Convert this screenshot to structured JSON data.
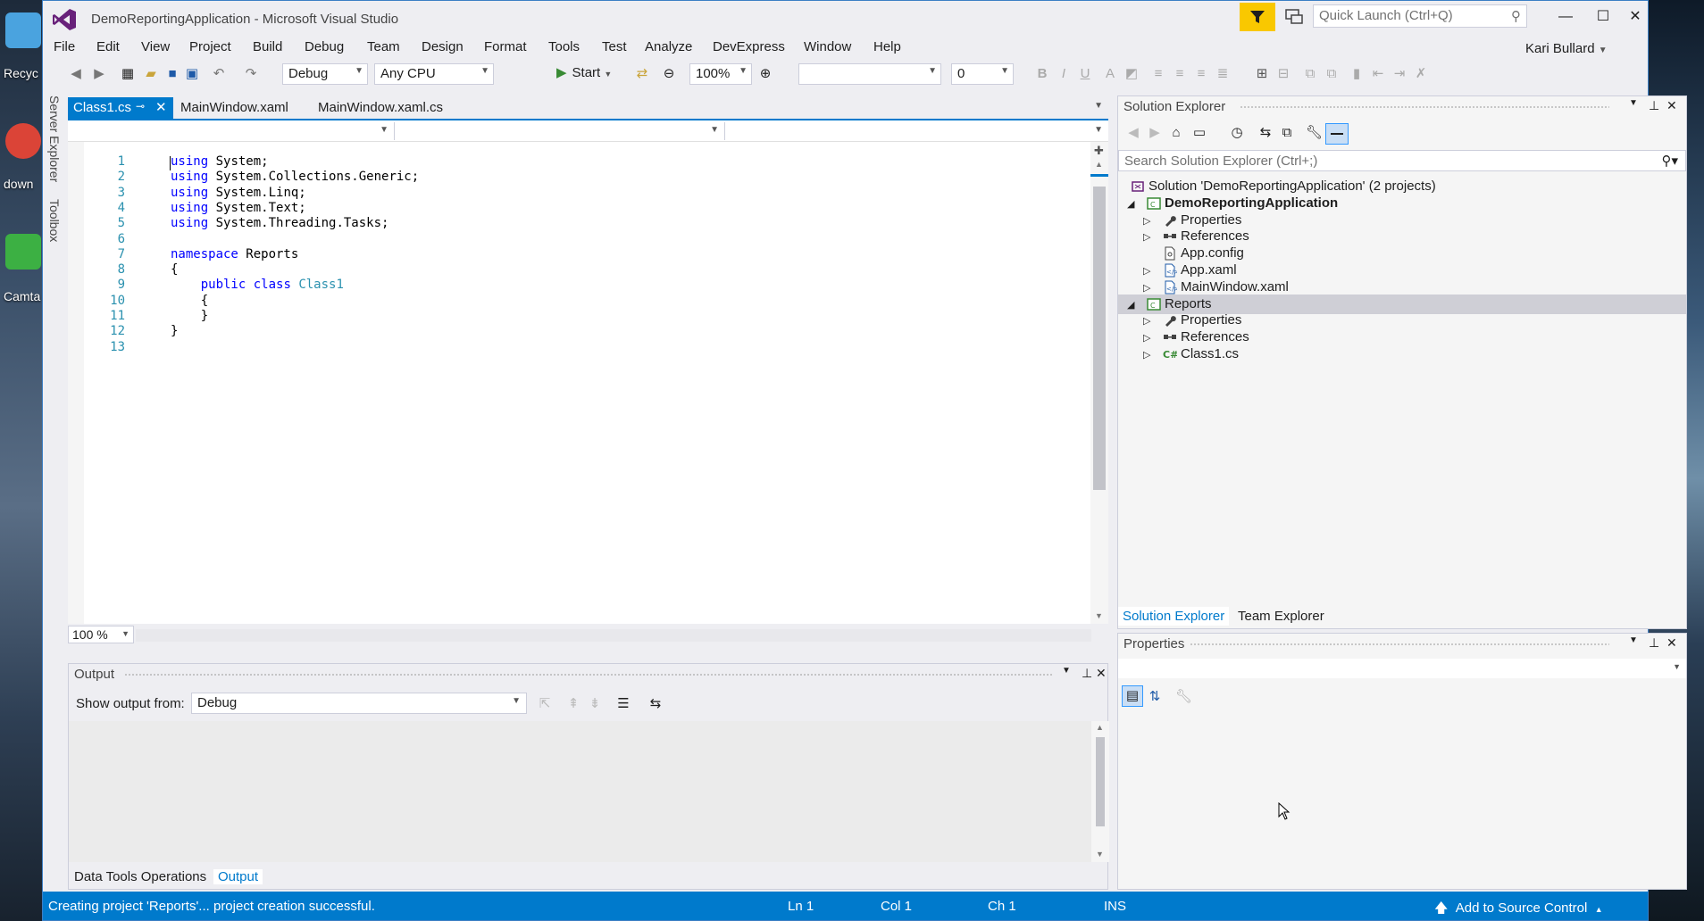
{
  "desktop": {
    "icons": [
      {
        "label": "Recyc",
        "color": "#4aa3df"
      },
      {
        "label": "down",
        "color": "#db4437"
      },
      {
        "label": "Camta",
        "color": "#3cb043"
      }
    ]
  },
  "window": {
    "title": "DemoReportingApplication - Microsoft Visual Studio",
    "quick_launch_placeholder": "Quick Launch (Ctrl+Q)",
    "minimize": "—",
    "maximize": "☐",
    "close": "✕"
  },
  "menu": [
    "File",
    "Edit",
    "View",
    "Project",
    "Build",
    "Debug",
    "Team",
    "Design",
    "Format",
    "Tools",
    "Test",
    "Analyze",
    "DevExpress",
    "Window",
    "Help"
  ],
  "user": {
    "name": "Kari Bullard"
  },
  "toolbar": {
    "config": "Debug",
    "platform": "Any CPU",
    "start_label": "Start",
    "zoom": "100%",
    "font_size": "0"
  },
  "side_tabs": {
    "server_explorer": "Server Explorer",
    "toolbox": "Toolbox"
  },
  "editor": {
    "tabs": [
      {
        "label": "Class1.cs",
        "active": true
      },
      {
        "label": "MainWindow.xaml",
        "active": false
      },
      {
        "label": "MainWindow.xaml.cs",
        "active": false
      }
    ],
    "lines": [
      {
        "n": "1",
        "parts": [
          [
            "kw",
            "using"
          ],
          [
            "t",
            " System;"
          ]
        ]
      },
      {
        "n": "2",
        "parts": [
          [
            "kw",
            "using"
          ],
          [
            "t",
            " System.Collections.Generic;"
          ]
        ]
      },
      {
        "n": "3",
        "parts": [
          [
            "kw",
            "using"
          ],
          [
            "t",
            " System.Linq;"
          ]
        ]
      },
      {
        "n": "4",
        "parts": [
          [
            "kw",
            "using"
          ],
          [
            "t",
            " System.Text;"
          ]
        ]
      },
      {
        "n": "5",
        "parts": [
          [
            "kw",
            "using"
          ],
          [
            "t",
            " System.Threading.Tasks;"
          ]
        ]
      },
      {
        "n": "6",
        "parts": []
      },
      {
        "n": "7",
        "parts": [
          [
            "kw",
            "namespace"
          ],
          [
            "t",
            " Reports"
          ]
        ]
      },
      {
        "n": "8",
        "parts": [
          [
            "t",
            "{"
          ]
        ]
      },
      {
        "n": "9",
        "parts": [
          [
            "t",
            "    "
          ],
          [
            "kw",
            "public"
          ],
          [
            "t",
            " "
          ],
          [
            "kw",
            "class"
          ],
          [
            "t",
            " "
          ],
          [
            "ty",
            "Class1"
          ]
        ]
      },
      {
        "n": "10",
        "parts": [
          [
            "t",
            "    {"
          ]
        ]
      },
      {
        "n": "11",
        "parts": [
          [
            "t",
            "    }"
          ]
        ]
      },
      {
        "n": "12",
        "parts": [
          [
            "t",
            "}"
          ]
        ]
      },
      {
        "n": "13",
        "parts": []
      }
    ],
    "zoom": "100 %"
  },
  "output": {
    "title": "Output",
    "show_from_label": "Show output from:",
    "show_from_value": "Debug",
    "tabs": [
      {
        "label": "Data Tools Operations",
        "active": false
      },
      {
        "label": "Output",
        "active": true
      }
    ]
  },
  "solution_explorer": {
    "title": "Solution Explorer",
    "search_placeholder": "Search Solution Explorer (Ctrl+;)",
    "tree": [
      {
        "label": "Solution 'DemoReportingApplication' (2 projects)",
        "level": 0,
        "expander": "",
        "icon": "solution-icon",
        "bold": false,
        "selected": false
      },
      {
        "label": "DemoReportingApplication",
        "level": 1,
        "expander": "◢",
        "icon": "csproj-icon",
        "bold": true,
        "selected": false
      },
      {
        "label": "Properties",
        "level": 2,
        "expander": "▷",
        "icon": "wrench-icon",
        "bold": false,
        "selected": false
      },
      {
        "label": "References",
        "level": 2,
        "expander": "▷",
        "icon": "references-icon",
        "bold": false,
        "selected": false
      },
      {
        "label": "App.config",
        "level": 2,
        "expander": "",
        "icon": "config-file-icon",
        "bold": false,
        "selected": false
      },
      {
        "label": "App.xaml",
        "level": 2,
        "expander": "▷",
        "icon": "xaml-file-icon",
        "bold": false,
        "selected": false
      },
      {
        "label": "MainWindow.xaml",
        "level": 2,
        "expander": "▷",
        "icon": "xaml-file-icon",
        "bold": false,
        "selected": false
      },
      {
        "label": "Reports",
        "level": 1,
        "expander": "◢",
        "icon": "csproj-icon",
        "bold": false,
        "selected": true
      },
      {
        "label": "Properties",
        "level": 2,
        "expander": "▷",
        "icon": "wrench-icon",
        "bold": false,
        "selected": false
      },
      {
        "label": "References",
        "level": 2,
        "expander": "▷",
        "icon": "references-icon",
        "bold": false,
        "selected": false
      },
      {
        "label": "Class1.cs",
        "level": 2,
        "expander": "▷",
        "icon": "csharp-file-icon",
        "bold": false,
        "selected": false
      }
    ],
    "bottom_tabs": [
      {
        "label": "Solution Explorer",
        "active": true
      },
      {
        "label": "Team Explorer",
        "active": false
      }
    ]
  },
  "properties": {
    "title": "Properties"
  },
  "status": {
    "message": "Creating project 'Reports'... project creation successful.",
    "ln": "Ln 1",
    "col": "Col 1",
    "ch": "Ch 1",
    "mode": "INS",
    "source_control": "Add to Source Control"
  },
  "colors": {
    "accent": "#007acc",
    "keyword": "#0000ff",
    "type": "#2b91af",
    "filter_badge": "#f9c800"
  }
}
